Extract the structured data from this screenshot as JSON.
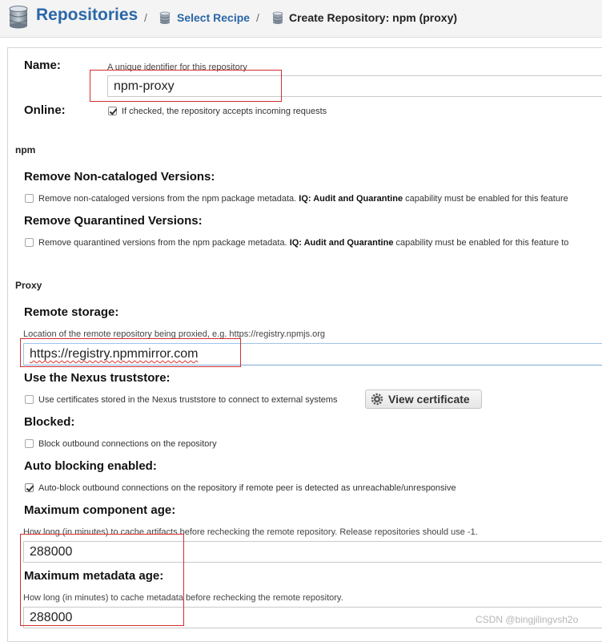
{
  "breadcrumb": {
    "title": "Repositories",
    "separator": "/",
    "link": "Select Recipe",
    "current": "Create Repository: npm (proxy)"
  },
  "form": {
    "name_label": "Name:",
    "name_help": "A unique identifier for this repository",
    "name_value": "npm-proxy",
    "online_label": "Online:",
    "online_text": "If checked, the repository accepts incoming requests",
    "online_checked": true,
    "npm_section": "npm",
    "remove_noncat_label": "Remove Non-cataloged Versions:",
    "remove_noncat_text": "Remove non-cataloged versions from the npm package metadata.",
    "remove_noncat_bold": "IQ: Audit and Quarantine",
    "remove_noncat_tail": "capability must be enabled for this feature",
    "remove_quar_label": "Remove Quarantined Versions:",
    "remove_quar_text": "Remove quarantined versions from the npm package metadata.",
    "remove_quar_bold": "IQ: Audit and Quarantine",
    "remove_quar_tail": "capability must be enabled for this feature to",
    "proxy_section": "Proxy",
    "remote_label": "Remote storage:",
    "remote_help": "Location of the remote repository being proxied, e.g. https://registry.npmjs.org",
    "remote_value": "https://registry.npmmirror.com",
    "truststore_label": "Use the Nexus truststore:",
    "truststore_text": "Use certificates stored in the Nexus truststore to connect to external systems",
    "view_cert_label": "View certificate",
    "blocked_label": "Blocked:",
    "blocked_text": "Block outbound connections on the repository",
    "auto_block_label": "Auto blocking enabled:",
    "auto_block_text": "Auto-block outbound connections on the repository if remote peer is detected as unreachable/unresponsive",
    "auto_block_checked": true,
    "max_comp_label": "Maximum component age:",
    "max_comp_help": "How long (in minutes) to cache artifacts before rechecking the remote repository. Release repositories should use -1.",
    "max_comp_value": "288000",
    "max_meta_label": "Maximum metadata age:",
    "max_meta_help": "How long (in minutes) to cache metadata before rechecking the remote repository.",
    "max_meta_value": "288000"
  },
  "watermark": "CSDN @bingjilingvsh2o",
  "colors": {
    "link": "#2a67a8",
    "highlight": "#d32f2f"
  }
}
